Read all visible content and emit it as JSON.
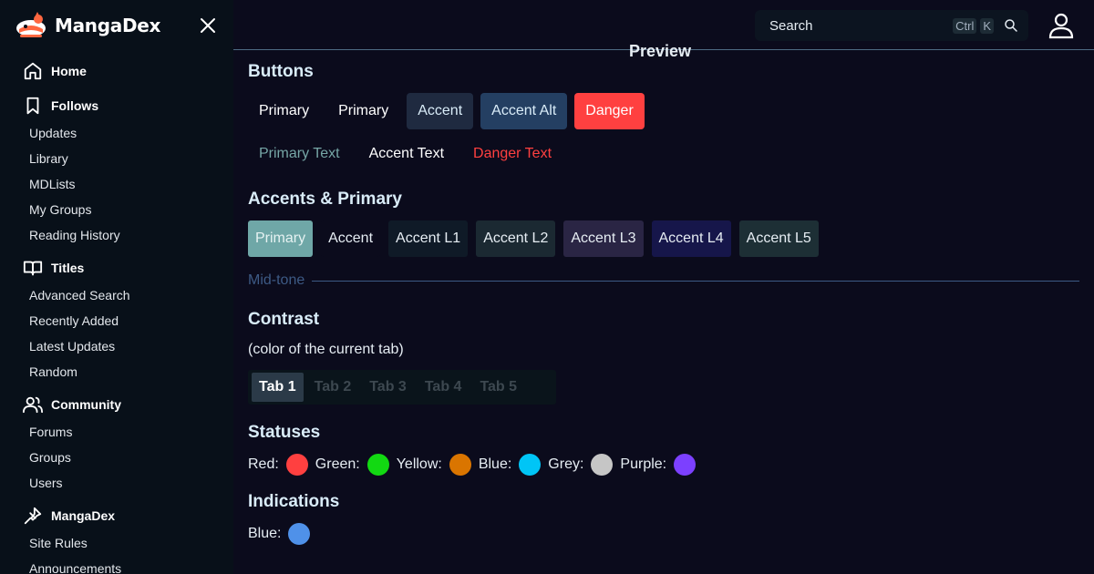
{
  "brand": {
    "name": "MangaDex",
    "accent": "#ff6740"
  },
  "sidebar": {
    "close_icon": "close-icon",
    "sections": [
      {
        "label": "Home",
        "icon": "home-icon",
        "items": []
      },
      {
        "label": "Follows",
        "icon": "bookmark-icon",
        "items": [
          "Updates",
          "Library",
          "MDLists",
          "My Groups",
          "Reading History"
        ]
      },
      {
        "label": "Titles",
        "icon": "book-open-icon",
        "items": [
          "Advanced Search",
          "Recently Added",
          "Latest Updates",
          "Random"
        ]
      },
      {
        "label": "Community",
        "icon": "users-icon",
        "items": [
          "Forums",
          "Groups",
          "Users"
        ]
      },
      {
        "label": "MangaDex",
        "icon": "pin-icon",
        "items": [
          "Site Rules",
          "Announcements"
        ]
      }
    ]
  },
  "topbar": {
    "search_placeholder": "Search",
    "kbd_ctrl": "Ctrl",
    "kbd_k": "K"
  },
  "main": {
    "preview_title": "Preview",
    "buttons": {
      "heading": "Buttons",
      "row1": [
        {
          "label": "Primary",
          "bg": "transparent",
          "fg": "#ffffff"
        },
        {
          "label": "Primary",
          "bg": "transparent",
          "fg": "#ffffff"
        },
        {
          "label": "Accent",
          "bg": "#1f2a40",
          "fg": "#d9ecf8"
        },
        {
          "label": "Accent Alt",
          "bg": "#243f62",
          "fg": "#d9ecf8"
        },
        {
          "label": "Danger",
          "bg": "#ff4040",
          "fg": "#ffffff"
        }
      ],
      "row2": [
        {
          "label": "Primary Text",
          "fg": "#76a6a6"
        },
        {
          "label": "Accent Text",
          "fg": "#ffffff"
        },
        {
          "label": "Danger Text",
          "fg": "#ff4040"
        }
      ]
    },
    "accents": {
      "heading": "Accents & Primary",
      "chips": [
        {
          "label": "Primary",
          "bg": "#6fa7a7",
          "fg": "#e6f2f2"
        },
        {
          "label": "Accent",
          "bg": "#0b0b1c",
          "fg": "#e6edf3"
        },
        {
          "label": "Accent L1",
          "bg": "#0f1a27",
          "fg": "#e6edf3"
        },
        {
          "label": "Accent L2",
          "bg": "#1b2932",
          "fg": "#e6edf3"
        },
        {
          "label": "Accent L3",
          "bg": "#2a2544",
          "fg": "#e6edf3"
        },
        {
          "label": "Accent L4",
          "bg": "#16164a",
          "fg": "#e6edf3"
        },
        {
          "label": "Accent L5",
          "bg": "#1d2f35",
          "fg": "#e6edf3"
        }
      ],
      "midtone": "Mid-tone"
    },
    "contrast": {
      "heading": "Contrast",
      "subtext": "(color of the current tab)",
      "tabs": [
        "Tab 1",
        "Tab 2",
        "Tab 3",
        "Tab 4",
        "Tab 5"
      ],
      "active_tab": 0
    },
    "statuses": {
      "heading": "Statuses",
      "items": [
        {
          "label": "Red:",
          "color": "#ff4040"
        },
        {
          "label": "Green:",
          "color": "#12d912"
        },
        {
          "label": "Yellow:",
          "color": "#da7500"
        },
        {
          "label": "Blue:",
          "color": "#00c5f6"
        },
        {
          "label": "Grey:",
          "color": "#c6c6c6"
        },
        {
          "label": "Purple:",
          "color": "#7c40ff"
        }
      ]
    },
    "indications": {
      "heading": "Indications",
      "items": [
        {
          "label": "Blue:",
          "color": "#4f91e9"
        }
      ]
    }
  }
}
